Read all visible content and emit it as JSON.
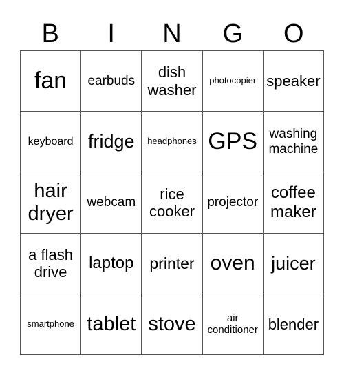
{
  "header": [
    "B",
    "I",
    "N",
    "G",
    "O"
  ],
  "cells": [
    "fan",
    "earbuds",
    "dish washer",
    "photocopier",
    "speaker",
    "keyboard",
    "fridge",
    "headphones",
    "GPS",
    "washing machine",
    "hair dryer",
    "webcam",
    "rice cooker",
    "projector",
    "coffee maker",
    "a flash drive",
    "laptop",
    "printer",
    "oven",
    "juicer",
    "smartphone",
    "tablet",
    "stove",
    "air conditioner",
    "blender"
  ]
}
